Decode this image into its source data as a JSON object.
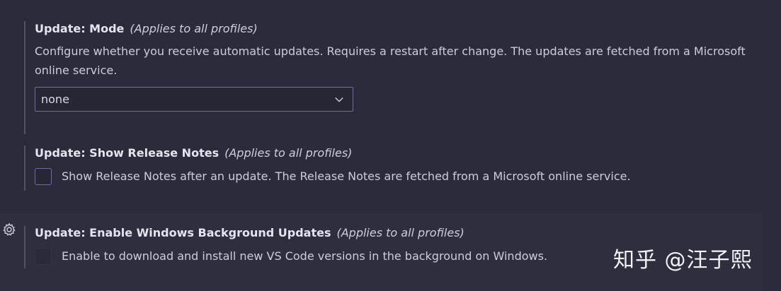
{
  "settings": [
    {
      "category": "Update: ",
      "name": "Mode",
      "scope": "(Applies to all profiles)",
      "description": "Configure whether you receive automatic updates. Requires a restart after change. The updates are fetched from a Microsoft online service.",
      "control": "select",
      "value": "none"
    },
    {
      "category": "Update: ",
      "name": "Show Release Notes",
      "scope": "(Applies to all profiles)",
      "control": "checkbox",
      "checked": false,
      "checkbox_label": "Show Release Notes after an update. The Release Notes are fetched from a Microsoft online service."
    },
    {
      "category": "Update: ",
      "name": "Enable Windows Background Updates",
      "scope": "(Applies to all profiles)",
      "control": "checkbox",
      "checked": false,
      "disabled": true,
      "checkbox_label": "Enable to download and install new VS Code versions in the background on Windows."
    }
  ],
  "icons": {
    "select_chevron": "chevron-down-icon",
    "manage": "gear-icon"
  },
  "watermark": "知乎 @汪子熙",
  "colors": {
    "background": "#2b2b3c",
    "focus_border": "#7566b5",
    "indicator_bar": "#4a5468"
  }
}
